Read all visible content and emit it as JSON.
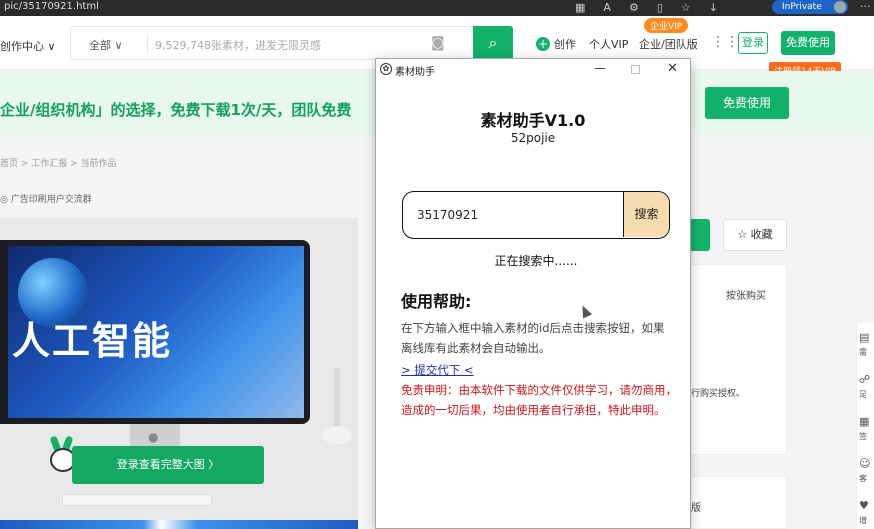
{
  "browser": {
    "url": "pic/35170921.html",
    "inprivate_label": "InPrivate",
    "more": "···"
  },
  "header": {
    "center_label": "创作中心 ∨",
    "category": "全部 ∨",
    "search_placeholder": "9,529,748张素材，进发无限灵感",
    "create_label": "创作",
    "personal_vip": "个人VIP",
    "team_vip": "企业/团队版",
    "vip_badge": "企业VIP",
    "login": "登录",
    "free_use": "免费使用",
    "register_badge": "注册领14天VIP"
  },
  "promo": {
    "text": "企业/组织机构」的选择，免费下载1次/天，团队免费",
    "button": "免费使用"
  },
  "content": {
    "breadcrumb": "首页 > 工作汇报 > 当前作品",
    "group_label": "◎ 广告印刷用户交流群",
    "preview_title": "人工智能",
    "preview_button": "登录查看完整大图 〉"
  },
  "right": {
    "favorite": "☆ 收藏",
    "by_sheet": "按张购买",
    "auth_fragment": "行购买授权。",
    "ban_fragment": "版"
  },
  "sidebar": {
    "items": [
      {
        "icon": "需"
      },
      {
        "icon": "足"
      },
      {
        "icon": "签"
      },
      {
        "icon": "客"
      },
      {
        "icon": "增"
      }
    ]
  },
  "dialog": {
    "title": "素材助手",
    "app_name": "素材助手V1.0",
    "subtitle": "52pojie",
    "input_value": "35170921",
    "search_button": "搜索",
    "status": "正在搜索中......",
    "help_title": "使用帮助:",
    "help_text": "在下方输入框中输入素材的id后点击搜索按钮，如果离线库有此素材会自动输出。",
    "submit_link": "> 提交代下 <",
    "disclaimer": "免责申明：由本软件下载的文件仅供学习，请勿商用，造成的一切后果，均由使用者自行承担，特此申明。"
  },
  "colors": {
    "brand_green": "#13b26b",
    "vip_orange": "#ff8a1f",
    "disclaimer_red": "#c8141a",
    "link_blue": "#1f2fa8",
    "search_btn_bg": "#f7dcb2"
  }
}
